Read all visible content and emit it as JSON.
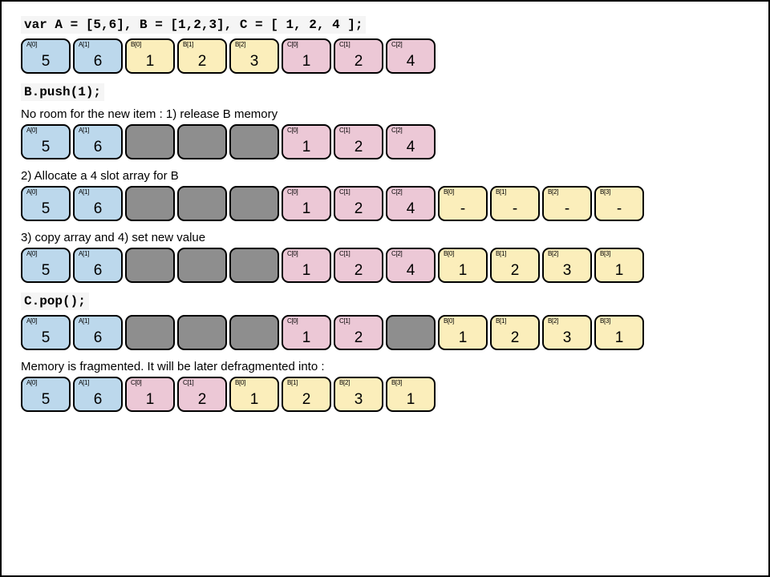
{
  "colors": {
    "A": "blue",
    "B": "cream",
    "C": "pink",
    "free": "grey"
  },
  "lines": {
    "decl": "var A = [5,6],  B = [1,2,3], C = [ 1, 2, 4 ];",
    "push": "B.push(1);",
    "noroom": "No room for the new item : 1) release B memory",
    "alloc": "2) Allocate a 4 slot array for B",
    "copy": "3) copy array and 4) set new value",
    "pop": "C.pop();",
    "frag": "Memory is fragmented. It will be later defragmented into :"
  },
  "rows": {
    "r1": [
      {
        "lbl": "A[0]",
        "val": "5",
        "c": "blue"
      },
      {
        "lbl": "A[1]",
        "val": "6",
        "c": "blue"
      },
      {
        "lbl": "B[0]",
        "val": "1",
        "c": "cream"
      },
      {
        "lbl": "B[1]",
        "val": "2",
        "c": "cream"
      },
      {
        "lbl": "B[2]",
        "val": "3",
        "c": "cream"
      },
      {
        "lbl": "C[0]",
        "val": "1",
        "c": "pink"
      },
      {
        "lbl": "C[1]",
        "val": "2",
        "c": "pink"
      },
      {
        "lbl": "C[2]",
        "val": "4",
        "c": "pink"
      }
    ],
    "r2": [
      {
        "lbl": "A[0]",
        "val": "5",
        "c": "blue"
      },
      {
        "lbl": "A[1]",
        "val": "6",
        "c": "blue"
      },
      {
        "lbl": "",
        "val": "",
        "c": "grey"
      },
      {
        "lbl": "",
        "val": "",
        "c": "grey"
      },
      {
        "lbl": "",
        "val": "",
        "c": "grey"
      },
      {
        "lbl": "C[0]",
        "val": "1",
        "c": "pink"
      },
      {
        "lbl": "C[1]",
        "val": "2",
        "c": "pink"
      },
      {
        "lbl": "C[2]",
        "val": "4",
        "c": "pink"
      }
    ],
    "r3": [
      {
        "lbl": "A[0]",
        "val": "5",
        "c": "blue"
      },
      {
        "lbl": "A[1]",
        "val": "6",
        "c": "blue"
      },
      {
        "lbl": "",
        "val": "",
        "c": "grey"
      },
      {
        "lbl": "",
        "val": "",
        "c": "grey"
      },
      {
        "lbl": "",
        "val": "",
        "c": "grey"
      },
      {
        "lbl": "C[0]",
        "val": "1",
        "c": "pink"
      },
      {
        "lbl": "C[1]",
        "val": "2",
        "c": "pink"
      },
      {
        "lbl": "C[2]",
        "val": "4",
        "c": "pink"
      },
      {
        "lbl": "B[0]",
        "val": "-",
        "c": "cream"
      },
      {
        "lbl": "B[1]",
        "val": "-",
        "c": "cream"
      },
      {
        "lbl": "B[2]",
        "val": "-",
        "c": "cream"
      },
      {
        "lbl": "B[3]",
        "val": "-",
        "c": "cream"
      }
    ],
    "r4": [
      {
        "lbl": "A[0]",
        "val": "5",
        "c": "blue"
      },
      {
        "lbl": "A[1]",
        "val": "6",
        "c": "blue"
      },
      {
        "lbl": "",
        "val": "",
        "c": "grey"
      },
      {
        "lbl": "",
        "val": "",
        "c": "grey"
      },
      {
        "lbl": "",
        "val": "",
        "c": "grey"
      },
      {
        "lbl": "C[0]",
        "val": "1",
        "c": "pink"
      },
      {
        "lbl": "C[1]",
        "val": "2",
        "c": "pink"
      },
      {
        "lbl": "C[2]",
        "val": "4",
        "c": "pink"
      },
      {
        "lbl": "B[0]",
        "val": "1",
        "c": "cream"
      },
      {
        "lbl": "B[1]",
        "val": "2",
        "c": "cream"
      },
      {
        "lbl": "B[2]",
        "val": "3",
        "c": "cream"
      },
      {
        "lbl": "B[3]",
        "val": "1",
        "c": "cream"
      }
    ],
    "r5": [
      {
        "lbl": "A[0]",
        "val": "5",
        "c": "blue"
      },
      {
        "lbl": "A[1]",
        "val": "6",
        "c": "blue"
      },
      {
        "lbl": "",
        "val": "",
        "c": "grey"
      },
      {
        "lbl": "",
        "val": "",
        "c": "grey"
      },
      {
        "lbl": "",
        "val": "",
        "c": "grey"
      },
      {
        "lbl": "C[0]",
        "val": "1",
        "c": "pink"
      },
      {
        "lbl": "C[1]",
        "val": "2",
        "c": "pink"
      },
      {
        "lbl": "",
        "val": "",
        "c": "grey"
      },
      {
        "lbl": "B[0]",
        "val": "1",
        "c": "cream"
      },
      {
        "lbl": "B[1]",
        "val": "2",
        "c": "cream"
      },
      {
        "lbl": "B[2]",
        "val": "3",
        "c": "cream"
      },
      {
        "lbl": "B[3]",
        "val": "1",
        "c": "cream"
      }
    ],
    "r6": [
      {
        "lbl": "A[0]",
        "val": "5",
        "c": "blue"
      },
      {
        "lbl": "A[1]",
        "val": "6",
        "c": "blue"
      },
      {
        "lbl": "C[0]",
        "val": "1",
        "c": "pink"
      },
      {
        "lbl": "C[1]",
        "val": "2",
        "c": "pink"
      },
      {
        "lbl": "B[0]",
        "val": "1",
        "c": "cream"
      },
      {
        "lbl": "B[1]",
        "val": "2",
        "c": "cream"
      },
      {
        "lbl": "B[2]",
        "val": "3",
        "c": "cream"
      },
      {
        "lbl": "B[3]",
        "val": "1",
        "c": "cream"
      }
    ]
  }
}
